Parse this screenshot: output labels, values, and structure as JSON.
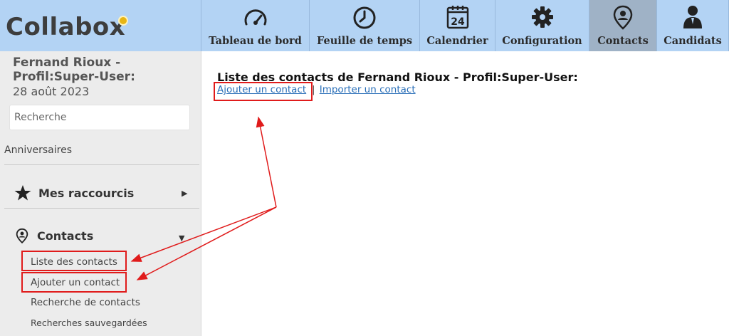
{
  "app": {
    "logo_text": "Collabox"
  },
  "nav": [
    {
      "label": "Tableau de bord",
      "icon": "gauge-icon"
    },
    {
      "label": "Feuille de temps",
      "icon": "clock-icon"
    },
    {
      "label": "Calendrier",
      "icon": "calendar-icon",
      "day": "24"
    },
    {
      "label": "Configuration",
      "icon": "gear-icon"
    },
    {
      "label": "Contacts",
      "icon": "contact-pin-icon",
      "active": true
    },
    {
      "label": "Candidats",
      "icon": "person-icon"
    }
  ],
  "sidebar": {
    "user_name": "Fernand Rioux - Profil:Super-User:",
    "date": "28 août 2023",
    "search_placeholder": "Recherche",
    "anniversaires": "Anniversaires",
    "shortcuts": {
      "label": "Mes raccourcis",
      "icon": "star-icon"
    },
    "contacts": {
      "label": "Contacts",
      "icon": "contact-pin-icon",
      "items": [
        "Liste des contacts",
        "Ajouter un contact",
        "Recherche de contacts",
        "Recherches sauvegardées"
      ]
    }
  },
  "main": {
    "title": "Liste des contacts de Fernand Rioux - Profil:Super-User:",
    "add_link": "Ajouter un contact",
    "separator": "|",
    "import_link": "Importer un contact"
  },
  "colors": {
    "topbar": "#b3d3f4",
    "active_tab": "#9fb2c6",
    "sidebar": "#ececec",
    "link": "#2a6fb8",
    "annotation": "#e01b1b"
  }
}
